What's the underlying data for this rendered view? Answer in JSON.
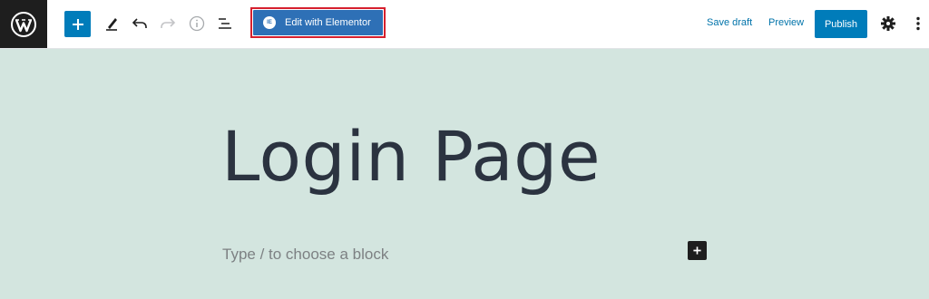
{
  "toolbar": {
    "add_block_icon": "plus-icon",
    "tools_icon": "pencil-icon",
    "undo_icon": "undo-icon",
    "redo_icon": "redo-icon",
    "details_icon": "info-icon",
    "outline_icon": "list-view-icon",
    "elementor_label": "Edit with Elementor",
    "elementor_badge": "IE",
    "save_draft_label": "Save draft",
    "preview_label": "Preview",
    "publish_label": "Publish",
    "settings_icon": "gear-icon",
    "more_icon": "vertical-ellipsis-icon"
  },
  "editor": {
    "title": "Login Page",
    "block_placeholder": "Type / to choose a block"
  },
  "colors": {
    "accent": "#007cba",
    "elementor": "#2e70b6",
    "highlight_frame": "#d6202e",
    "canvas": "#d3e5df",
    "title_text": "#2b3340"
  }
}
